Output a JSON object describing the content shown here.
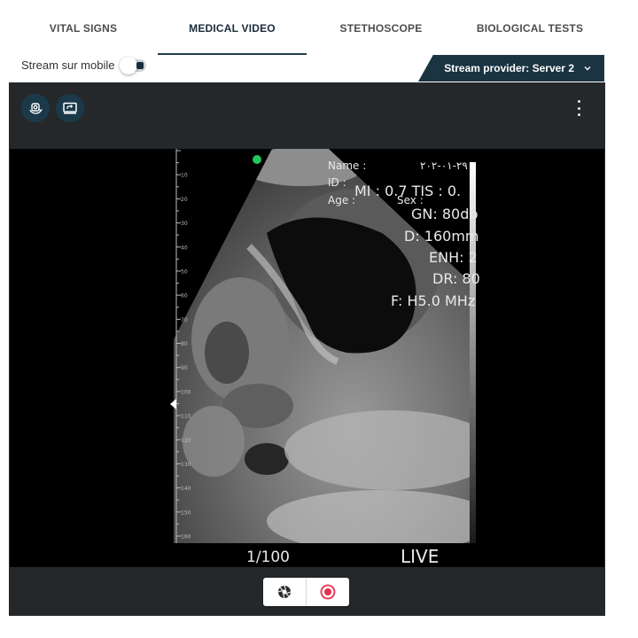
{
  "tabs": [
    {
      "label": "VITAL SIGNS",
      "active": false
    },
    {
      "label": "MEDICAL VIDEO",
      "active": true
    },
    {
      "label": "STETHOSCOPE",
      "active": false
    },
    {
      "label": "BIOLOGICAL TESTS",
      "active": false
    }
  ],
  "toolbar": {
    "stream_toggle_label": "Stream sur mobile",
    "stream_toggle_on": false,
    "provider_label": "Stream provider: Server 2"
  },
  "panel": {
    "left_icons": [
      "camera-switch-icon",
      "screen-share-icon"
    ],
    "menu_icon": "more-vertical-icon"
  },
  "ultrasound": {
    "name_label": "Name :",
    "id_label": "ID :",
    "age_label": "Age :",
    "sex_label": "Sex :",
    "date": "٢٩-٠١-٢٠٢",
    "mi_tis": "MI : 0.7  TIS : 0.",
    "gain": "GN: 80db",
    "depth": "D: 160mm",
    "enhancement": "ENH: 2",
    "dynamic_range": "DR: 80",
    "frequency": "F: H5.0 MHz",
    "frame": "1/100",
    "status": "LIVE",
    "depth_ticks": [
      "10",
      "20",
      "30",
      "40",
      "50",
      "60",
      "70",
      "80",
      "90",
      "100",
      "110",
      "120",
      "130",
      "140",
      "150",
      "160"
    ]
  },
  "bottom_controls": {
    "snapshot_icon": "camera-shutter-icon",
    "record_icon": "record-icon"
  },
  "colors": {
    "accent": "#1b3442",
    "record": "#e8304a",
    "indicator": "#22c55e"
  }
}
